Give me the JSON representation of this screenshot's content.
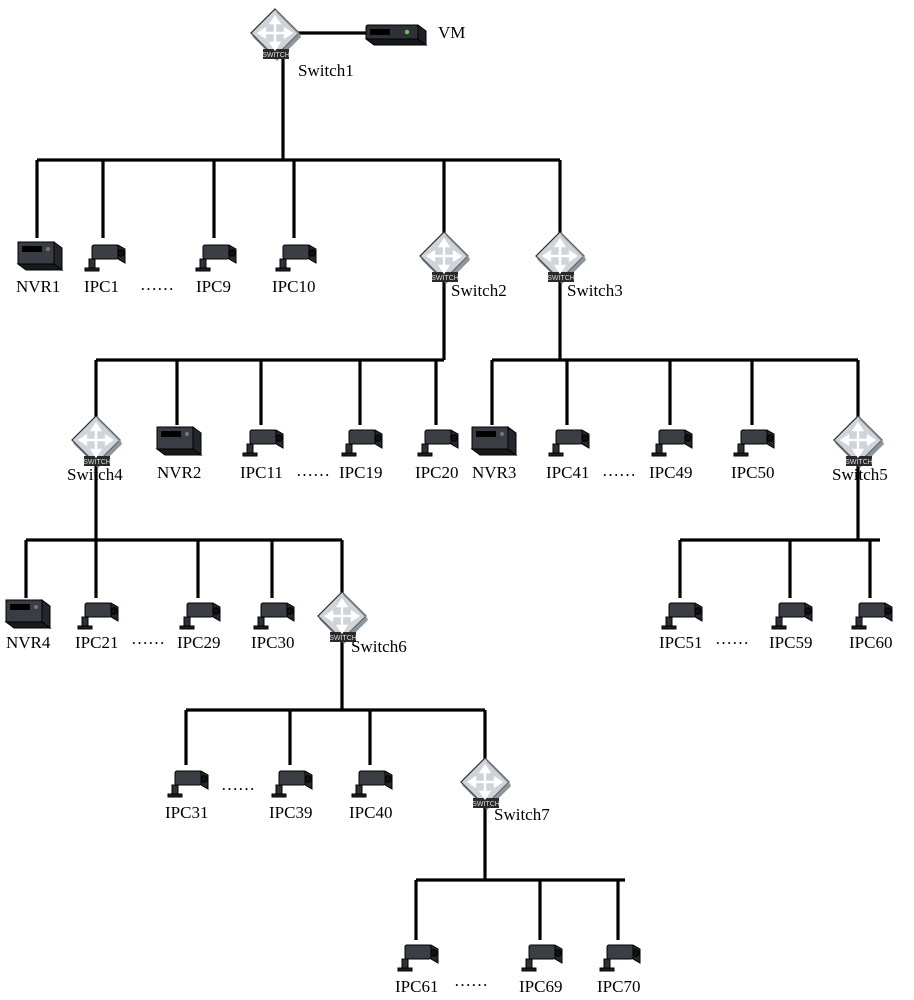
{
  "devices": {
    "vm": "VM",
    "switch1": "Switch1",
    "switch2": "Switch2",
    "switch3": "Switch3",
    "switch4": "Switch4",
    "switch5": "Switch5",
    "switch6": "Switch6",
    "switch7": "Switch7",
    "nvr1": "NVR1",
    "nvr2": "NVR2",
    "nvr3": "NVR3",
    "nvr4": "NVR4",
    "ipc1": "IPC1",
    "ipc9": "IPC9",
    "ipc10": "IPC10",
    "ipc11": "IPC11",
    "ipc19": "IPC19",
    "ipc20": "IPC20",
    "ipc21": "IPC21",
    "ipc29": "IPC29",
    "ipc30": "IPC30",
    "ipc31": "IPC31",
    "ipc39": "IPC39",
    "ipc40": "IPC40",
    "ipc41": "IPC41",
    "ipc49": "IPC49",
    "ipc50": "IPC50",
    "ipc51": "IPC51",
    "ipc59": "IPC59",
    "ipc60": "IPC60",
    "ipc61": "IPC61",
    "ipc69": "IPC69",
    "ipc70": "IPC70"
  },
  "ellipsis": "……"
}
